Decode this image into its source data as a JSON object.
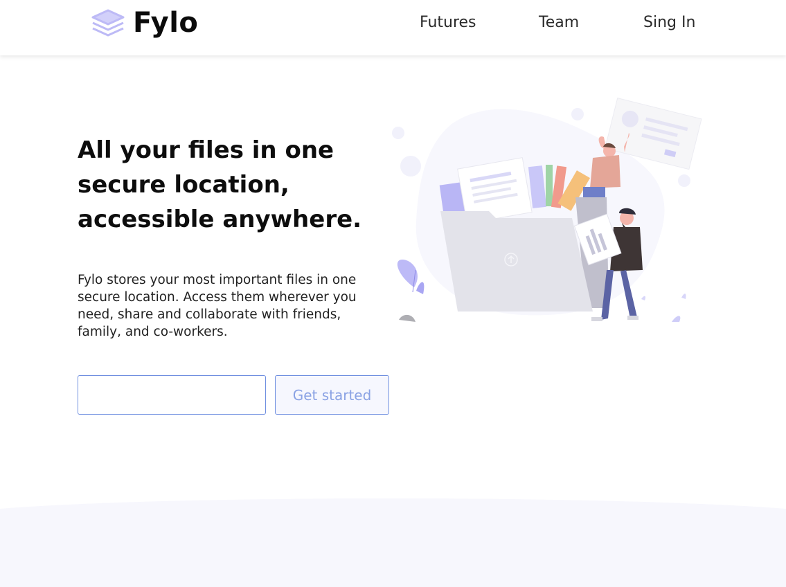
{
  "brand": {
    "name": "Fylo",
    "logo_icon": "stacked-layers-icon",
    "logo_color": "#c3c1f6"
  },
  "nav": {
    "items": [
      "Futures",
      "Team",
      "Sing In"
    ]
  },
  "hero": {
    "headline": "All your files in one secure location, accessible anywhere.",
    "description": "Fylo stores your most important files in one secure location. Access them wherever you need, share and collaborate with friends, family, and co-workers.",
    "email_value": "",
    "cta_label": "Get started",
    "illustration_icon": "file-sharing-illustration"
  },
  "colors": {
    "accent": "#6f8fe0",
    "button_text": "#8aa2e4",
    "illustration_purple": "#bdbaf7",
    "section_background": "#f7f7fd"
  }
}
